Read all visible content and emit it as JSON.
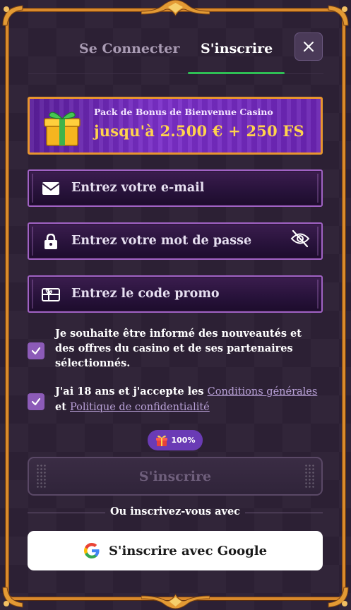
{
  "tabs": {
    "login_label": "Se Connecter",
    "signup_label": "S'inscrire"
  },
  "banner": {
    "subtitle": "Pack de Bonus de Bienvenue Casino",
    "headline": "jusqu'à 2.500 € + 250 FS"
  },
  "fields": {
    "email_placeholder": "Entrez votre e-mail",
    "password_placeholder": "Entrez votre mot de passe",
    "promo_placeholder": "Entrez le code promo"
  },
  "consents": {
    "newsletter_text": "Je souhaite être informé des nouveautés et des offres du casino et de ses partenaires sélectionnés.",
    "newsletter_checked": true,
    "terms_prefix": "J'ai 18 ans et j'accepte les ",
    "terms_link": "Conditions générales",
    "terms_middle": " et ",
    "privacy_link": "Politique de confidentialité",
    "terms_checked": true
  },
  "badge": {
    "value": "100%"
  },
  "submit": {
    "label": "S'inscrire"
  },
  "divider": {
    "label": "Ou inscrivez-vous avec"
  },
  "google": {
    "label": "S'inscrire avec Google"
  },
  "colors": {
    "accent_green": "#2fbf55",
    "frame_orange": "#d98a2c",
    "banner_gold": "#ffd34d",
    "checkbox_purple": "#8c5bb8",
    "field_border": "#a062c4"
  }
}
